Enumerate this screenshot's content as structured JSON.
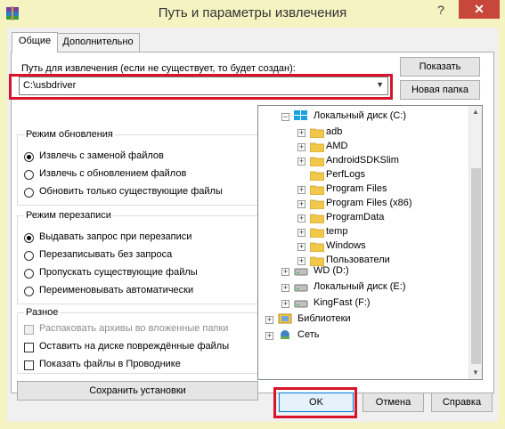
{
  "window": {
    "title": "Путь и параметры извлечения",
    "help": "?",
    "close": "✕"
  },
  "tabs": [
    {
      "label": "Общие",
      "active": true
    },
    {
      "label": "Дополнительно",
      "active": false
    }
  ],
  "path": {
    "label": "Путь для извлечения (если не существует, то будет создан):",
    "value": "C:\\usbdriver"
  },
  "buttons": {
    "show": "Показать",
    "new_folder": "Новая папка",
    "save_settings": "Сохранить установки",
    "ok": "OK",
    "cancel": "Отмена",
    "help": "Справка"
  },
  "update_mode": {
    "title": "Режим обновления",
    "options": [
      {
        "label": "Извлечь с заменой файлов",
        "selected": true
      },
      {
        "label": "Извлечь с обновлением файлов",
        "selected": false
      },
      {
        "label": "Обновить только существующие файлы",
        "selected": false
      }
    ]
  },
  "overwrite_mode": {
    "title": "Режим перезаписи",
    "options": [
      {
        "label": "Выдавать запрос при перезаписи",
        "selected": true
      },
      {
        "label": "Перезаписывать без запроса",
        "selected": false
      },
      {
        "label": "Пропускать существующие файлы",
        "selected": false
      },
      {
        "label": "Переименовывать автоматически",
        "selected": false
      }
    ]
  },
  "misc": {
    "title": "Разное",
    "options": [
      {
        "label": "Распаковать архивы во вложенные папки",
        "checked": false,
        "disabled": true
      },
      {
        "label": "Оставить на диске повреждённые файлы",
        "checked": false,
        "disabled": false
      },
      {
        "label": "Показать файлы в Проводнике",
        "checked": false,
        "disabled": false
      }
    ]
  },
  "tree": {
    "drive_c": "Локальный диск (C:)",
    "folders_c": [
      "adb",
      "AMD",
      "AndroidSDKSlim",
      "PerfLogs",
      "Program Files",
      "Program Files (x86)",
      "ProgramData",
      "temp",
      "Windows",
      "Пользователи"
    ],
    "others": [
      "WD (D:)",
      "Локальный диск (E:)",
      "KingFast (F:)",
      "Библиотеки",
      "Сеть"
    ]
  },
  "colors": {
    "highlight": "#d9142a",
    "close_button": "#c7473a",
    "frame": "#f6f3c2",
    "folder": "#f2c84b"
  }
}
